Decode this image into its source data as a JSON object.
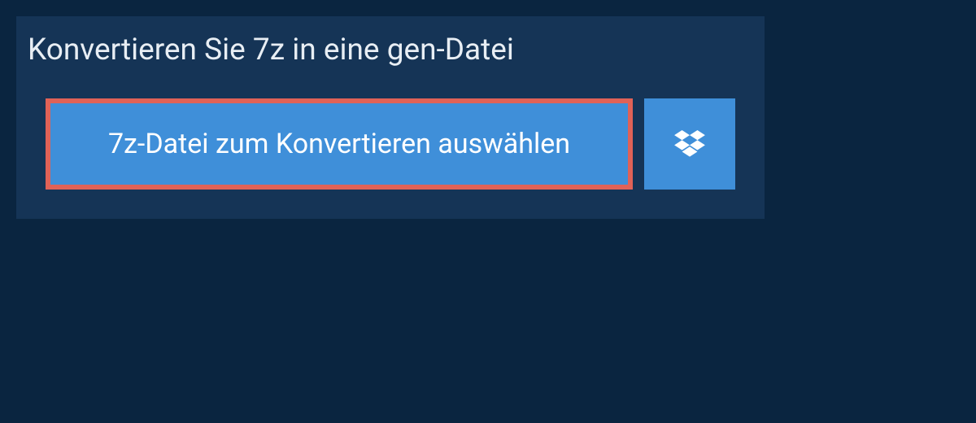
{
  "heading": "Konvertieren Sie 7z in eine gen-Datei",
  "select_file_label": "7z-Datei zum Konvertieren auswählen"
}
